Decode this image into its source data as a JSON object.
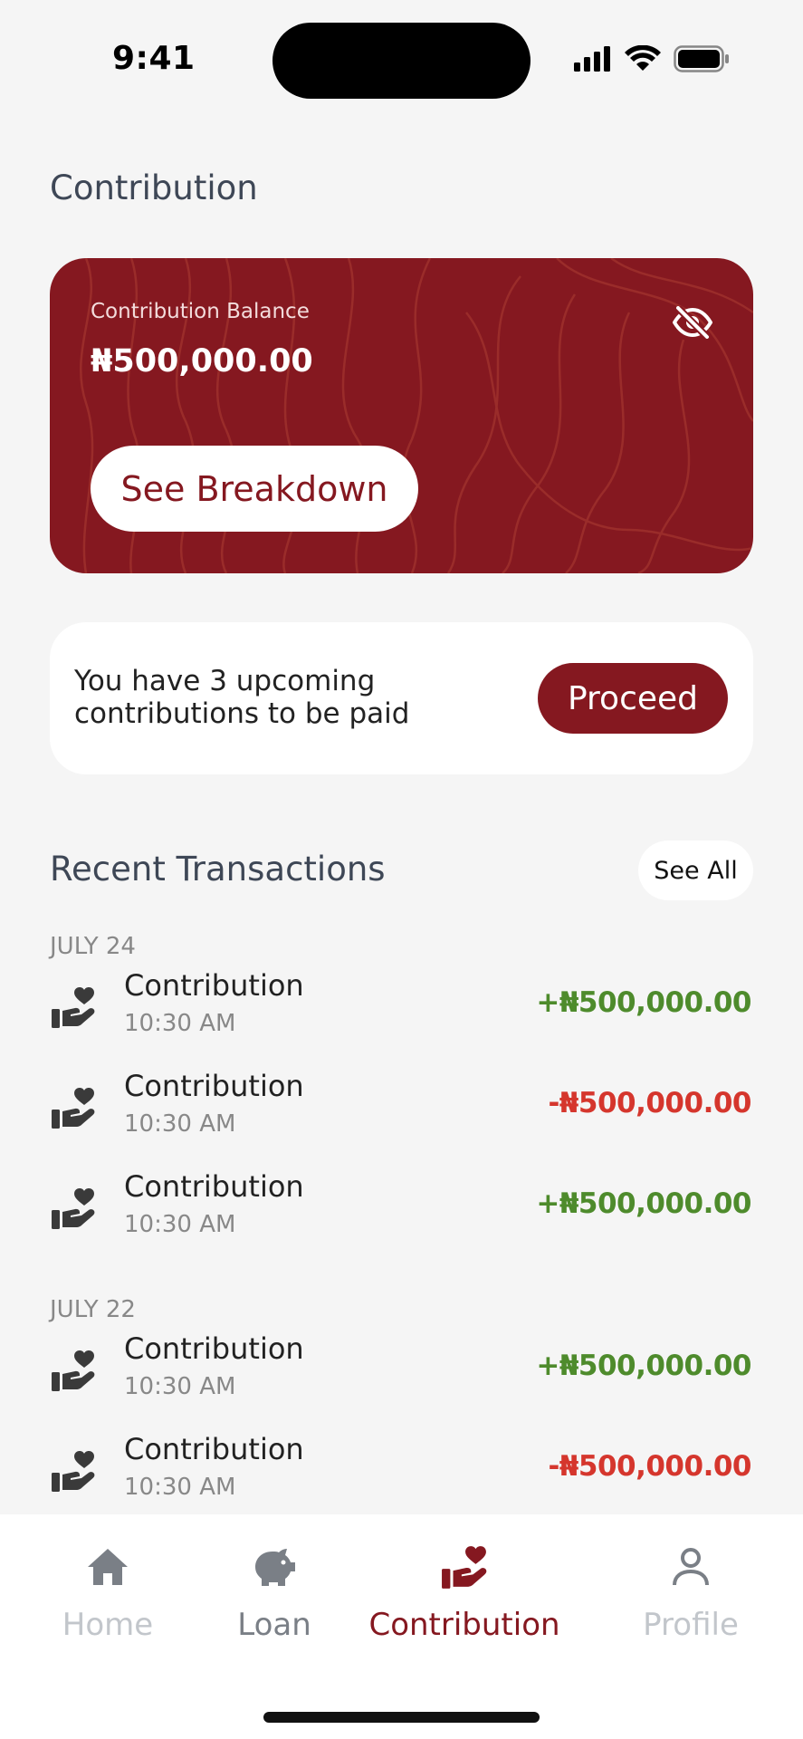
{
  "status_bar": {
    "time": "9:41"
  },
  "page_title": "Contribution",
  "balance_card": {
    "label": "Contribution Balance",
    "amount": "₦500,000.00",
    "breakdown_label": "See Breakdown",
    "card_color": "#851820"
  },
  "upcoming": {
    "text": "You have 3 upcoming contributions to be paid",
    "proceed_label": "Proceed"
  },
  "recent": {
    "title": "Recent Transactions",
    "see_all_label": "See All",
    "groups": [
      {
        "date": "JULY 24",
        "items": [
          {
            "name": "Contribution",
            "time": "10:30 AM",
            "amount": "+₦500,000.00",
            "type": "credit"
          },
          {
            "name": "Contribution",
            "time": "10:30 AM",
            "amount": "-₦500,000.00",
            "type": "debit"
          },
          {
            "name": "Contribution",
            "time": "10:30 AM",
            "amount": "+₦500,000.00",
            "type": "credit"
          }
        ]
      },
      {
        "date": "JULY 22",
        "items": [
          {
            "name": "Contribution",
            "time": "10:30 AM",
            "amount": "+₦500,000.00",
            "type": "credit"
          },
          {
            "name": "Contribution",
            "time": "10:30 AM",
            "amount": "-₦500,000.00",
            "type": "debit"
          }
        ]
      }
    ]
  },
  "nav": {
    "items": [
      {
        "label": "Home",
        "icon": "home-icon",
        "color": "#c2c6cb"
      },
      {
        "label": "Loan",
        "icon": "piggy-bank-icon",
        "color": "#7a7f86"
      },
      {
        "label": "Contribution",
        "icon": "hand-heart-icon",
        "color": "#851820",
        "active": true
      },
      {
        "label": "Profile",
        "icon": "user-icon",
        "color": "#c2c6cb"
      }
    ]
  },
  "colors": {
    "credit": "#4e8b2c",
    "debit": "#d5362d",
    "brand": "#851820"
  }
}
